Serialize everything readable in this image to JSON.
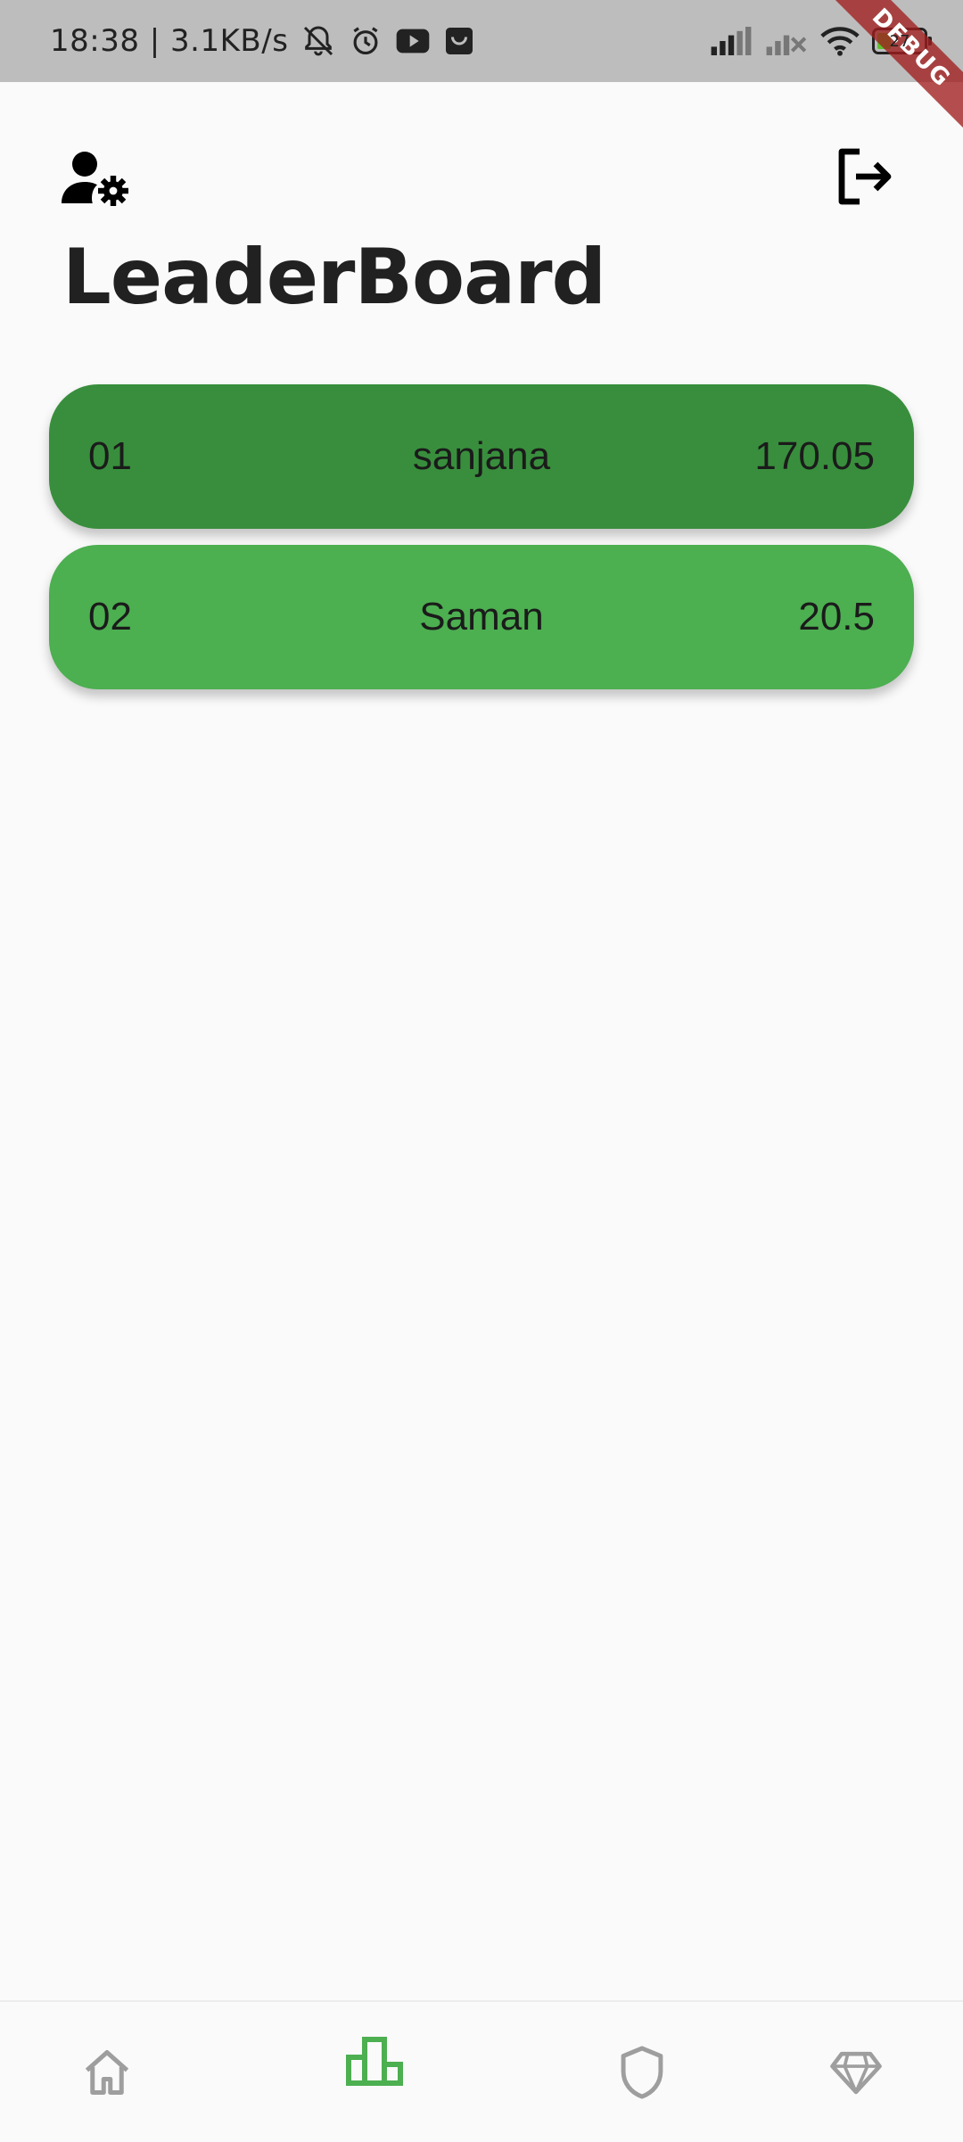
{
  "status_bar": {
    "time": "18:38 | 3.1KB/s",
    "icons": [
      "mute-bell-icon",
      "alarm-icon",
      "youtube-icon",
      "shopping-bag-icon",
      "signal-icon",
      "signal-off-icon",
      "wifi-icon"
    ],
    "battery_level": "27"
  },
  "debug_banner": "DEBUG",
  "header": {
    "profile_settings_icon": "manage-account-icon",
    "logout_icon": "logout-icon",
    "title": "LeaderBoard"
  },
  "leaderboard": [
    {
      "rank": "01",
      "name": "sanjana",
      "score": "170.05",
      "color": "#388E3C"
    },
    {
      "rank": "02",
      "name": "Saman",
      "score": "20.5",
      "color": "#4CAF50"
    }
  ],
  "bottom_nav": {
    "items": [
      {
        "icon": "home-icon",
        "active": false
      },
      {
        "icon": "leaderboard-icon",
        "active": true
      },
      {
        "icon": "shield-icon",
        "active": false
      },
      {
        "icon": "diamond-icon",
        "active": false
      }
    ],
    "active_color": "#4CAF50",
    "inactive_color": "#9E9E9E"
  }
}
